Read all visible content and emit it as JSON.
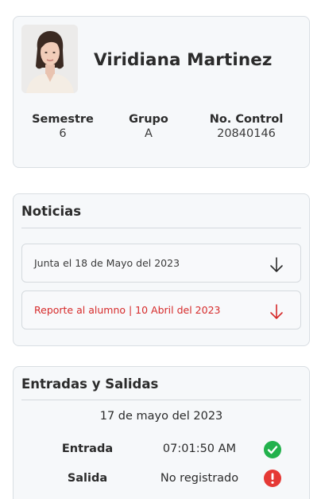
{
  "profile": {
    "name": "Viridiana Martinez",
    "photo_alt": "Viridiana Martinez",
    "stats": {
      "semestre": {
        "label": "Semestre",
        "value": "6"
      },
      "grupo": {
        "label": "Grupo",
        "value": "A"
      },
      "control": {
        "label": "No. Control",
        "value": "20840146"
      }
    }
  },
  "news": {
    "title": "Noticias",
    "items": [
      {
        "text": "Junta el 18 de Mayo del 2023",
        "icon": "arrow-down-icon",
        "color": "#2b2b2b"
      },
      {
        "text": "Reporte al alumno | 10 Abril del 2023",
        "icon": "arrow-down-icon",
        "color": "#d62a2a"
      }
    ]
  },
  "attendance": {
    "title": "Entradas y Salidas",
    "date": "17 de mayo del 2023",
    "rows": [
      {
        "label": "Entrada",
        "value": "07:01:50 AM",
        "status_icon": "check-circle-icon",
        "status_color": "#22b14c"
      },
      {
        "label": "Salida",
        "value": "No registrado",
        "status_icon": "exclamation-circle-icon",
        "status_color": "#e53935"
      }
    ]
  }
}
